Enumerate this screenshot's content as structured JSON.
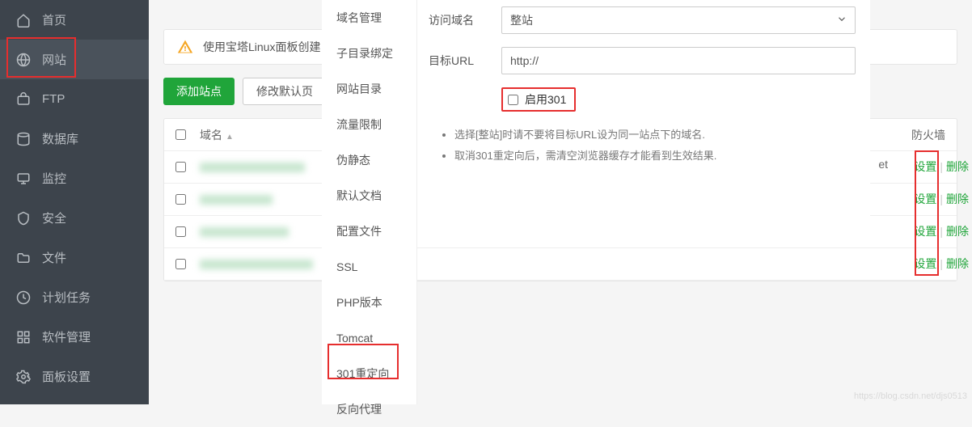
{
  "sidebar": {
    "items": [
      {
        "label": "首页"
      },
      {
        "label": "网站"
      },
      {
        "label": "FTP"
      },
      {
        "label": "数据库"
      },
      {
        "label": "监控"
      },
      {
        "label": "安全"
      },
      {
        "label": "文件"
      },
      {
        "label": "计划任务"
      },
      {
        "label": "软件管理"
      },
      {
        "label": "面板设置"
      }
    ]
  },
  "alert": {
    "text": "使用宝塔Linux面板创建"
  },
  "buttons": {
    "add": "添加站点",
    "default": "修改默认页"
  },
  "table": {
    "header_domain": "域名",
    "header_firewall": "防火墙",
    "net_text": "et"
  },
  "actions": {
    "set": "设置",
    "del": "删除"
  },
  "modal_menu": [
    "域名管理",
    "子目录绑定",
    "网站目录",
    "流量限制",
    "伪静态",
    "默认文档",
    "配置文件",
    "SSL",
    "PHP版本",
    "Tomcat",
    "301重定向",
    "反向代理"
  ],
  "form": {
    "label_domain": "访问域名",
    "select_value": "整站",
    "label_target": "目标URL",
    "target_value": "http://",
    "enable_label": "启用301"
  },
  "tips": [
    "选择[整站]时请不要将目标URL设为同一站点下的域名.",
    "取消301重定向后，需清空浏览器缓存才能看到生效结果."
  ],
  "watermark": "https://blog.csdn.net/djs0513"
}
